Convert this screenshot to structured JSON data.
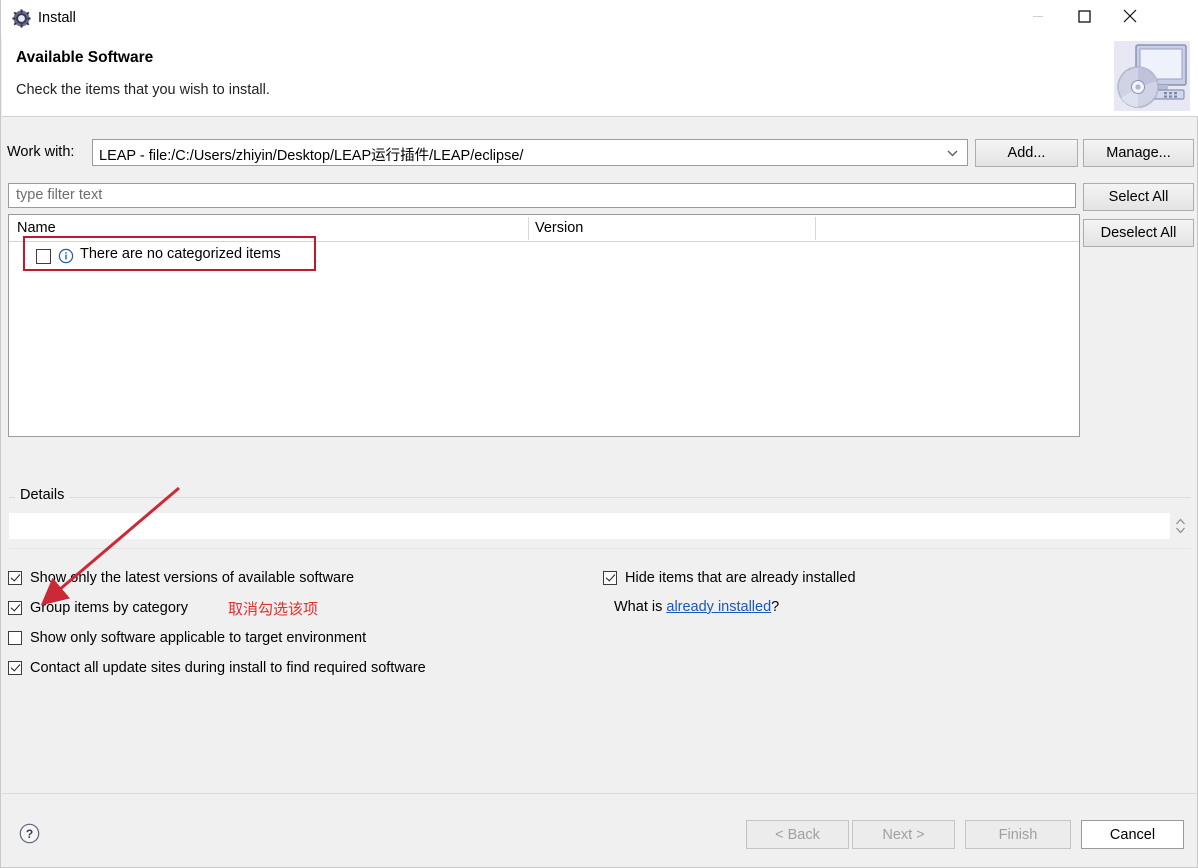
{
  "window": {
    "title": "Install",
    "icon": "install-gear-icon",
    "controls": {
      "minimize": "minimize-icon",
      "maximize": "maximize-icon",
      "close": "close-icon"
    }
  },
  "header": {
    "title": "Available Software",
    "description": "Check the items that you wish to install.",
    "icon": "computer-cd-icon"
  },
  "work_with": {
    "label": "Work with:",
    "value": "LEAP - file:/C:/Users/zhiyin/Desktop/LEAP运行插件/LEAP/eclipse/",
    "dropdown_icon": "chevron-down-icon",
    "add_label": "Add...",
    "manage_label": "Manage..."
  },
  "filter": {
    "placeholder": "type filter text",
    "value": ""
  },
  "side_buttons": {
    "select_all": "Select All",
    "deselect_all": "Deselect All"
  },
  "table": {
    "columns": [
      "Name",
      "Version"
    ],
    "rows": [
      {
        "checked": false,
        "icon": "info-icon",
        "name": "There are no categorized items",
        "version": ""
      }
    ]
  },
  "details": {
    "label": "Details",
    "value": "",
    "spinner_icon": "spinner-up-down-icon"
  },
  "options": {
    "left": [
      {
        "label": "Show only the latest versions of available software",
        "checked": true
      },
      {
        "label": "Group items by category",
        "checked": true
      },
      {
        "label": "Show only software applicable to target environment",
        "checked": false
      },
      {
        "label": "Contact all update sites during install to find required software",
        "checked": true
      }
    ],
    "right": [
      {
        "label": "Hide items that are already installed",
        "checked": true
      }
    ],
    "what_is_prefix": "What is ",
    "what_is_link": "already installed",
    "what_is_suffix": "?"
  },
  "annotations": {
    "chinese_note": "取消勾选该项",
    "highlight_color": "#c0192e",
    "arrow_color": "#cc2936",
    "note_color": "#e03030"
  },
  "footer": {
    "help_icon": "help-question-icon",
    "back": "< Back",
    "next": "Next >",
    "finish": "Finish",
    "cancel": "Cancel"
  }
}
